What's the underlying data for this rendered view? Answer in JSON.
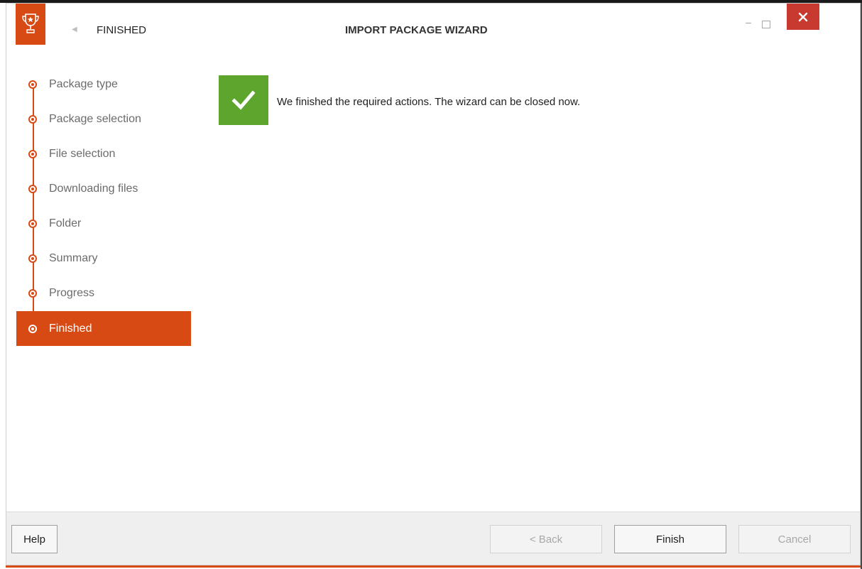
{
  "window": {
    "step_title": "FINISHED",
    "title": "IMPORT PACKAGE WIZARD",
    "app_icon": "trophy-icon",
    "accent_color": "#d84a14",
    "close_color": "#c8392f"
  },
  "steps": [
    {
      "label": "Package type",
      "active": false
    },
    {
      "label": "Package selection",
      "active": false
    },
    {
      "label": "File selection",
      "active": false
    },
    {
      "label": "Downloading files",
      "active": false
    },
    {
      "label": "Folder",
      "active": false
    },
    {
      "label": "Summary",
      "active": false
    },
    {
      "label": "Progress",
      "active": false
    },
    {
      "label": "Finished",
      "active": true
    }
  ],
  "content": {
    "status_icon": "checkmark-icon",
    "status_color": "#5ea52e",
    "message": "We finished the required actions. The wizard can be closed now."
  },
  "footer": {
    "help_label": "Help",
    "back_label": "< Back",
    "finish_label": "Finish",
    "cancel_label": "Cancel"
  }
}
